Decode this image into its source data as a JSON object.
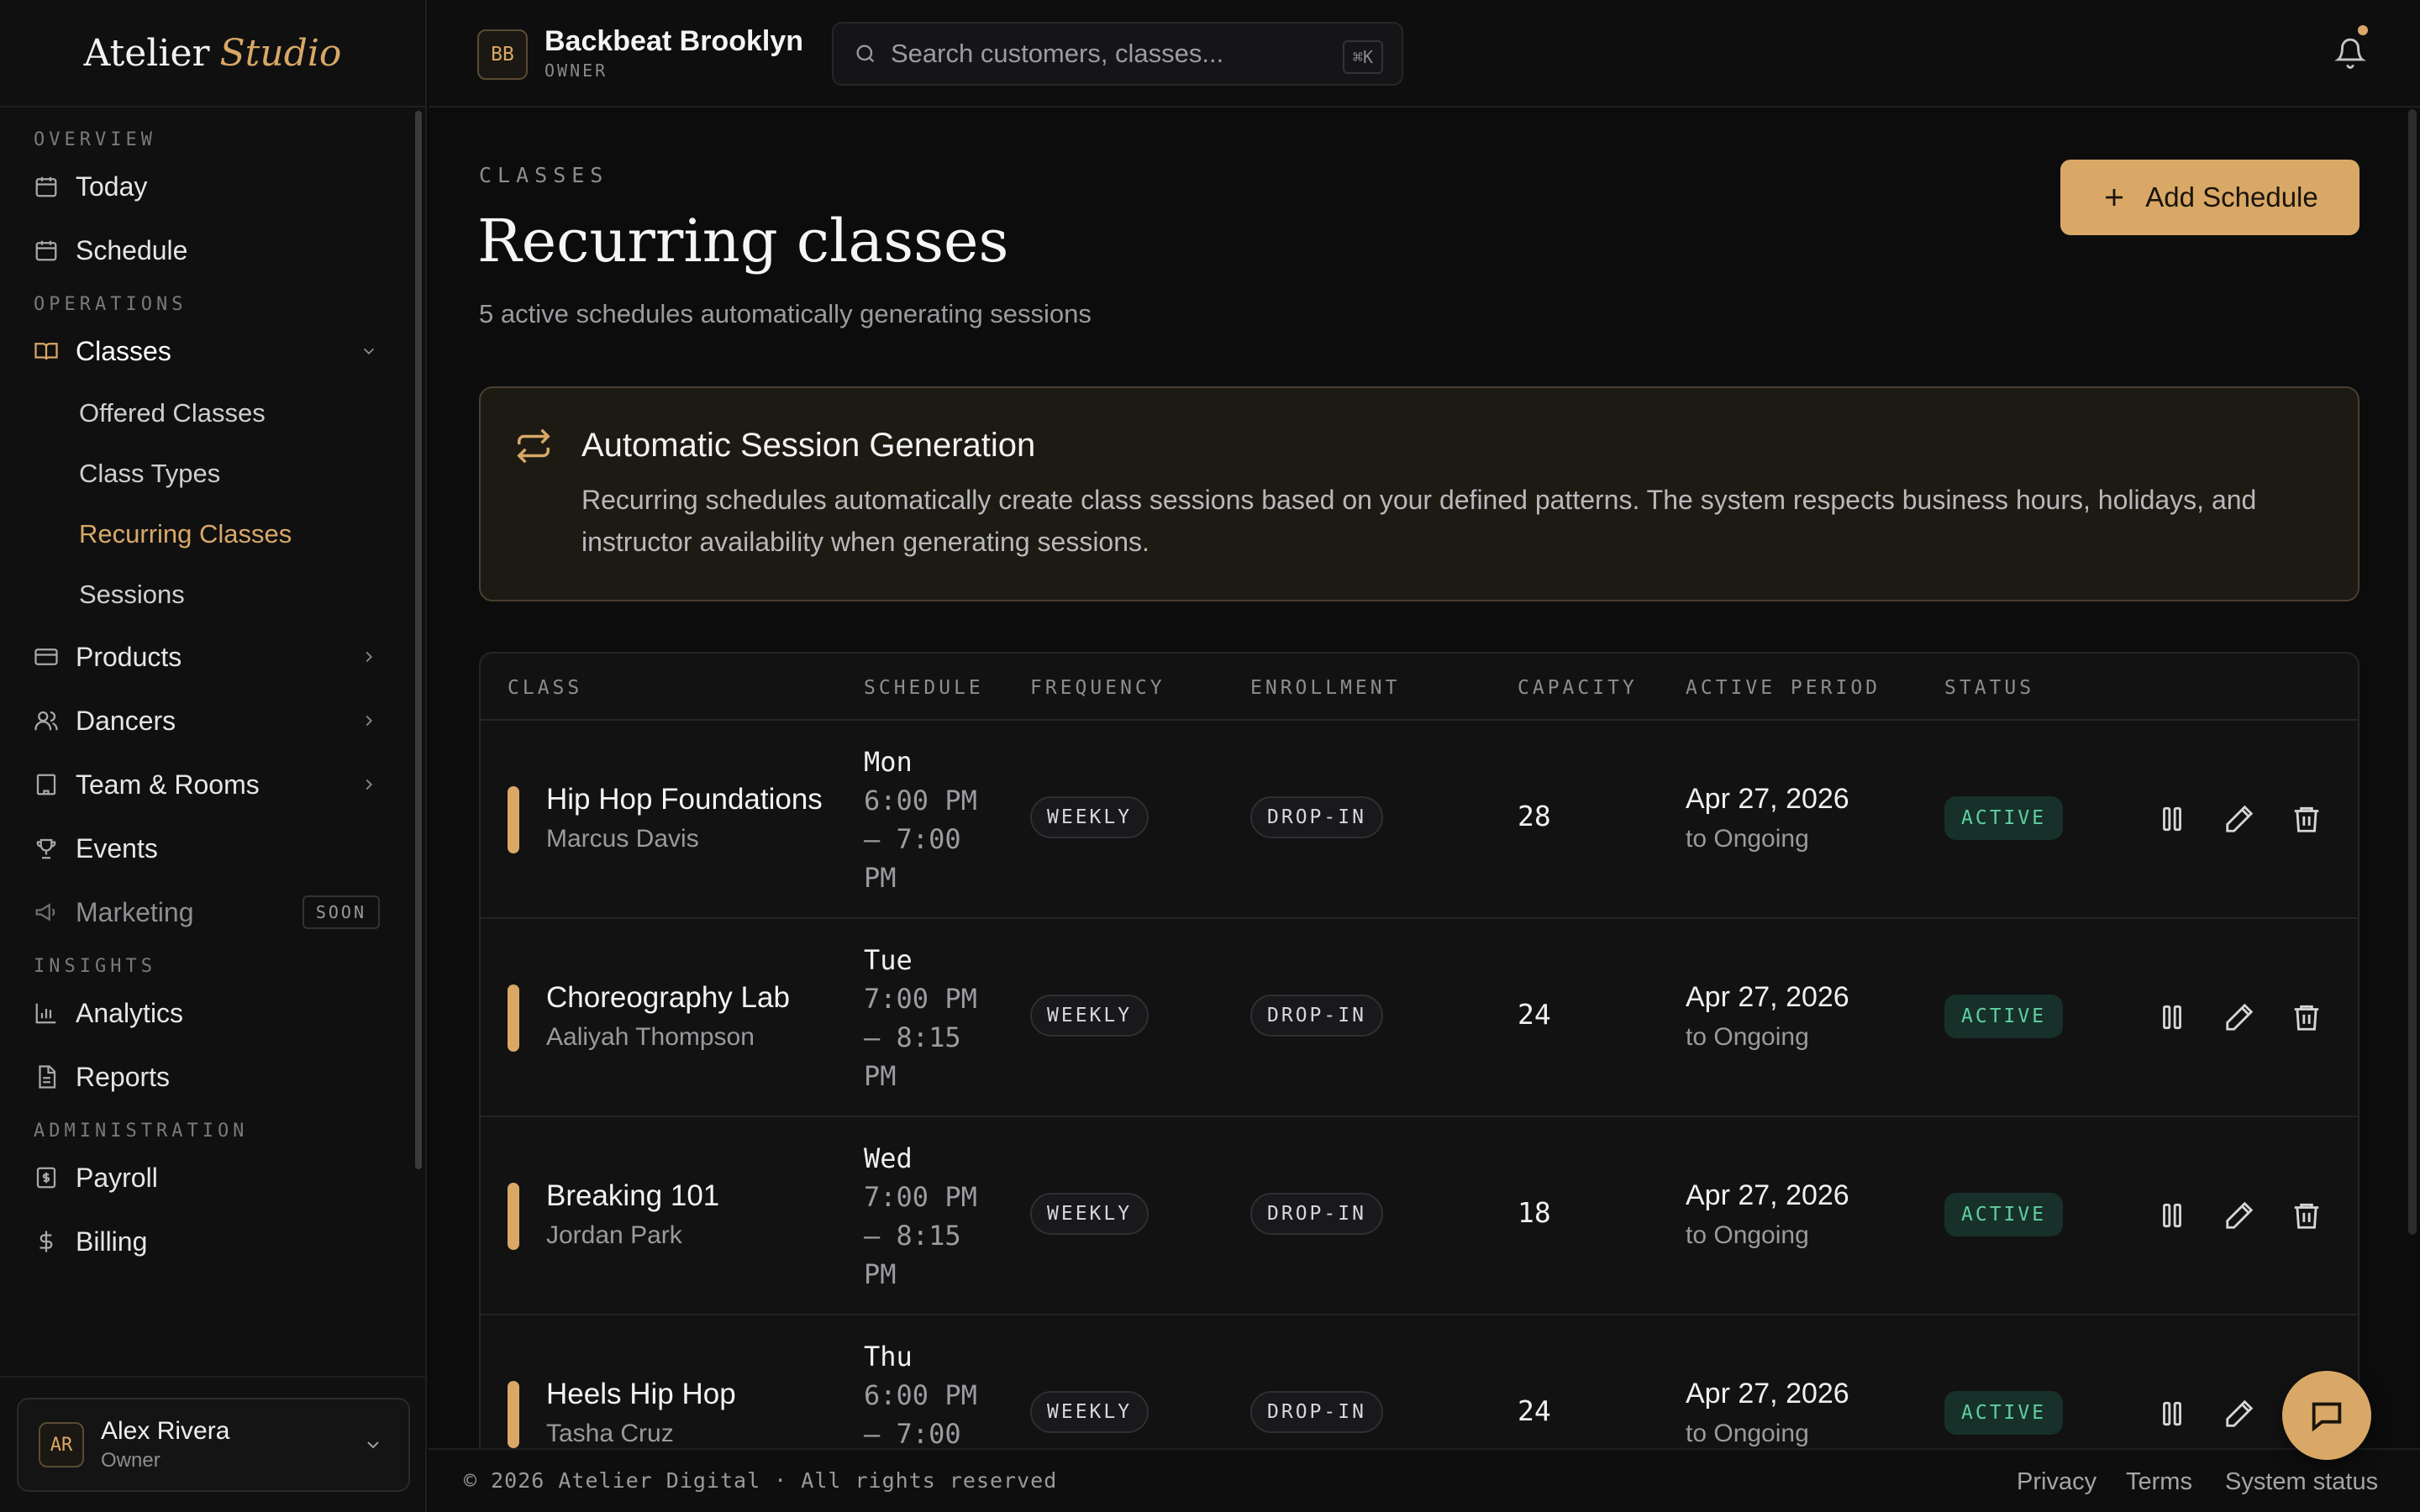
{
  "brand": {
    "name": "Atelier",
    "accent": "Studio"
  },
  "sidebar": {
    "sections": {
      "overview": "OVERVIEW",
      "operations": "OPERATIONS",
      "insights": "INSIGHTS",
      "administration": "ADMINISTRATION"
    },
    "items": {
      "today": "Today",
      "schedule": "Schedule",
      "classes": "Classes",
      "products": "Products",
      "dancers": "Dancers",
      "team_rooms": "Team & Rooms",
      "events": "Events",
      "marketing": "Marketing",
      "analytics": "Analytics",
      "reports": "Reports",
      "payroll": "Payroll",
      "billing": "Billing"
    },
    "class_sub": {
      "offered": "Offered Classes",
      "types": "Class Types",
      "recurring": "Recurring Classes",
      "sessions": "Sessions"
    },
    "soon_badge": "SOON",
    "user": {
      "initials": "AR",
      "name": "Alex Rivera",
      "role": "Owner"
    }
  },
  "topbar": {
    "org_initials": "BB",
    "org_name": "Backbeat Brooklyn",
    "org_role": "OWNER",
    "search_placeholder": "Search customers, classes...",
    "shortcut": "⌘K"
  },
  "page": {
    "eyebrow": "CLASSES",
    "title": "Recurring classes",
    "subtitle": "5 active schedules automatically generating sessions",
    "add_button": "Add Schedule"
  },
  "info": {
    "title": "Automatic Session Generation",
    "body": "Recurring schedules automatically create class sessions based on your defined patterns. The system respects business hours, holidays, and instructor availability when generating sessions."
  },
  "table": {
    "headers": {
      "class": "CLASS",
      "schedule": "SCHEDULE",
      "frequency": "FREQUENCY",
      "enrollment": "ENROLLMENT",
      "capacity": "CAPACITY",
      "period": "ACTIVE PERIOD",
      "status": "STATUS"
    },
    "rows": [
      {
        "name": "Hip Hop Foundations",
        "instructor": "Marcus Davis",
        "day": "Mon",
        "time": "6:00 PM – 7:00 PM",
        "frequency": "WEEKLY",
        "enrollment": "DROP-IN",
        "capacity": "28",
        "start": "Apr 27, 2026",
        "end": "to Ongoing",
        "status": "ACTIVE"
      },
      {
        "name": "Choreography Lab",
        "instructor": "Aaliyah Thompson",
        "day": "Tue",
        "time": "7:00 PM – 8:15 PM",
        "frequency": "WEEKLY",
        "enrollment": "DROP-IN",
        "capacity": "24",
        "start": "Apr 27, 2026",
        "end": "to Ongoing",
        "status": "ACTIVE"
      },
      {
        "name": "Breaking 101",
        "instructor": "Jordan Park",
        "day": "Wed",
        "time": "7:00 PM – 8:15 PM",
        "frequency": "WEEKLY",
        "enrollment": "DROP-IN",
        "capacity": "18",
        "start": "Apr 27, 2026",
        "end": "to Ongoing",
        "status": "ACTIVE"
      },
      {
        "name": "Heels Hip Hop",
        "instructor": "Tasha Cruz",
        "day": "Thu",
        "time": "6:00 PM – 7:00",
        "frequency": "WEEKLY",
        "enrollment": "DROP-IN",
        "capacity": "24",
        "start": "Apr 27, 2026",
        "end": "to Ongoing",
        "status": "ACTIVE"
      }
    ]
  },
  "footer": {
    "copyright": "© 2026 Atelier Digital · All rights reserved",
    "privacy": "Privacy",
    "terms": "Terms",
    "status": "System status"
  },
  "colors": {
    "accent": "#d9a866",
    "active_text": "#5fd0a0",
    "active_bg": "#17302a",
    "background": "#0c0c0d"
  }
}
